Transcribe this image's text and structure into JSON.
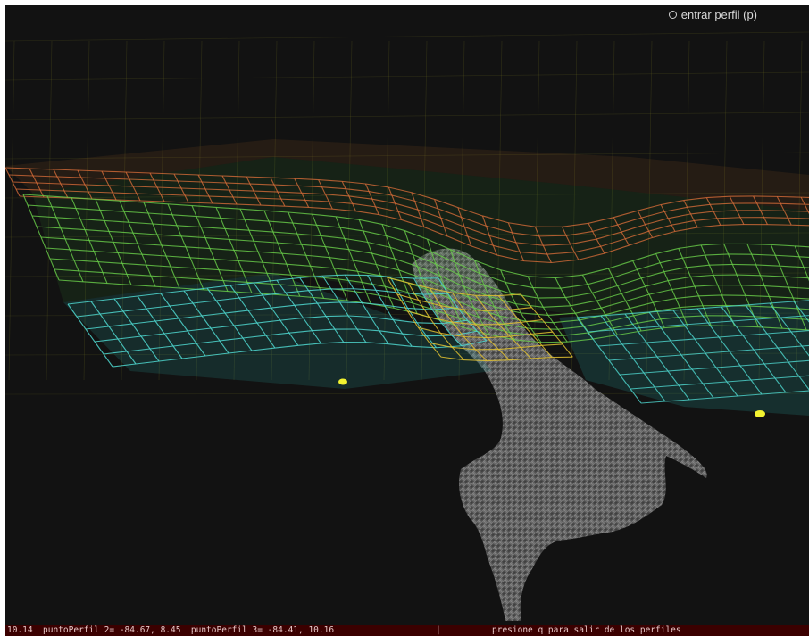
{
  "overlay": {
    "profile_toggle_label": "entrar perfil (p)"
  },
  "status_bar": {
    "left_text": "10.14  puntoPerfil 2= -84.67, 8.45  puntoPerfil 3= -84.41, 10.16",
    "separator": "|",
    "right_text": "presione q para salir de los perfiles"
  },
  "colors": {
    "background": "#121212",
    "status_bar": "#3b0000",
    "marker": "#f2f230",
    "terrain": "#8a8a8a"
  }
}
